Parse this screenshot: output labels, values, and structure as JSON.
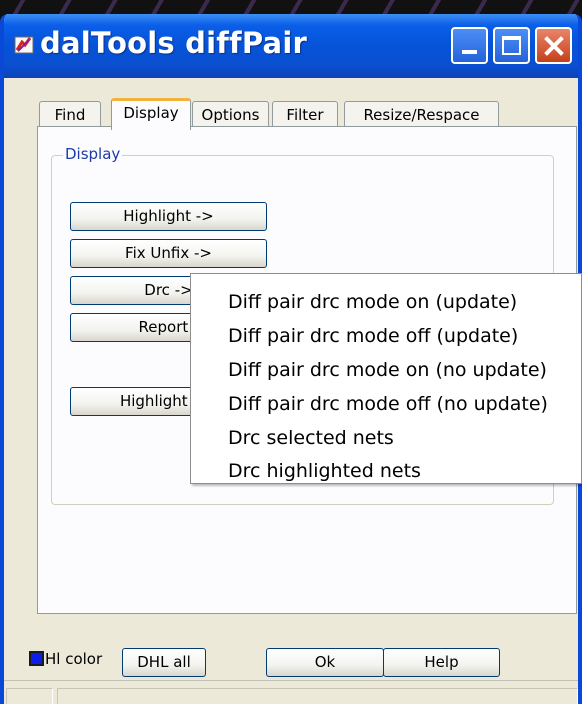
{
  "window": {
    "title": "dalTools diffPair"
  },
  "tabs": [
    {
      "label": "Find",
      "active": false
    },
    {
      "label": "Display",
      "active": true
    },
    {
      "label": "Options",
      "active": false
    },
    {
      "label": "Filter",
      "active": false
    },
    {
      "label": "Resize/Respace",
      "active": false
    }
  ],
  "display_group": {
    "label": "Display",
    "buttons": {
      "highlight": "Highlight ->",
      "fix_unfix": "Fix Unfix ->",
      "drc": "Drc ->",
      "report": "Report -",
      "highlight_other": "Highlight oth"
    }
  },
  "context_menu": {
    "items": [
      "Diff pair drc mode on (update)",
      "Diff pair drc mode off (update)",
      "Diff pair drc mode on (no update)",
      "Diff pair drc mode off (no update)",
      "Drc selected nets",
      "Drc highlighted nets"
    ]
  },
  "bottom_bar": {
    "hl_color_label": "Hl color",
    "hl_color_value": "#0b1fe8",
    "dhl_all": "DHL all",
    "ok": "Ok",
    "help": "Help"
  },
  "colors": {
    "titlebar": "#0653d8",
    "window_bg": "#ece9d8",
    "group_label": "#1c3ba8",
    "active_tab_accent": "#f2b33d",
    "close_button": "#c5401a"
  },
  "icons": {
    "app": "paintbrush-icon",
    "minimize": "minimize-icon",
    "maximize": "maximize-icon",
    "close": "close-icon"
  }
}
